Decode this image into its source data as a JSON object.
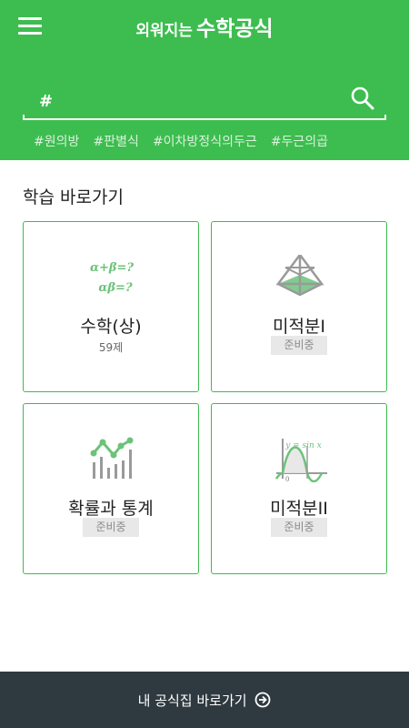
{
  "header": {
    "logo_small": "외워지는",
    "logo_big": "수학공식",
    "search_value": "#",
    "tags": [
      "#원의방",
      "#판별식",
      "#이차방정식의두근",
      "#두근의곱"
    ]
  },
  "section_title": "학습 바로가기",
  "cards": [
    {
      "title": "수학(상)",
      "subtitle": "59제",
      "icon_formula_1": "α+β=?",
      "icon_formula_2": "αβ=?"
    },
    {
      "title": "미적분I",
      "badge": "준비중"
    },
    {
      "title": "확률과 통계",
      "badge": "준비중"
    },
    {
      "title": "미적분II",
      "badge": "준비중",
      "icon_formula": "y = sin x",
      "icon_origin": "0"
    }
  ],
  "footer": {
    "label": "내 공식집 바로가기"
  },
  "colors": {
    "primary": "#3dbd4f",
    "footer": "#2f3a40",
    "badge_bg": "#e8e8e8"
  }
}
